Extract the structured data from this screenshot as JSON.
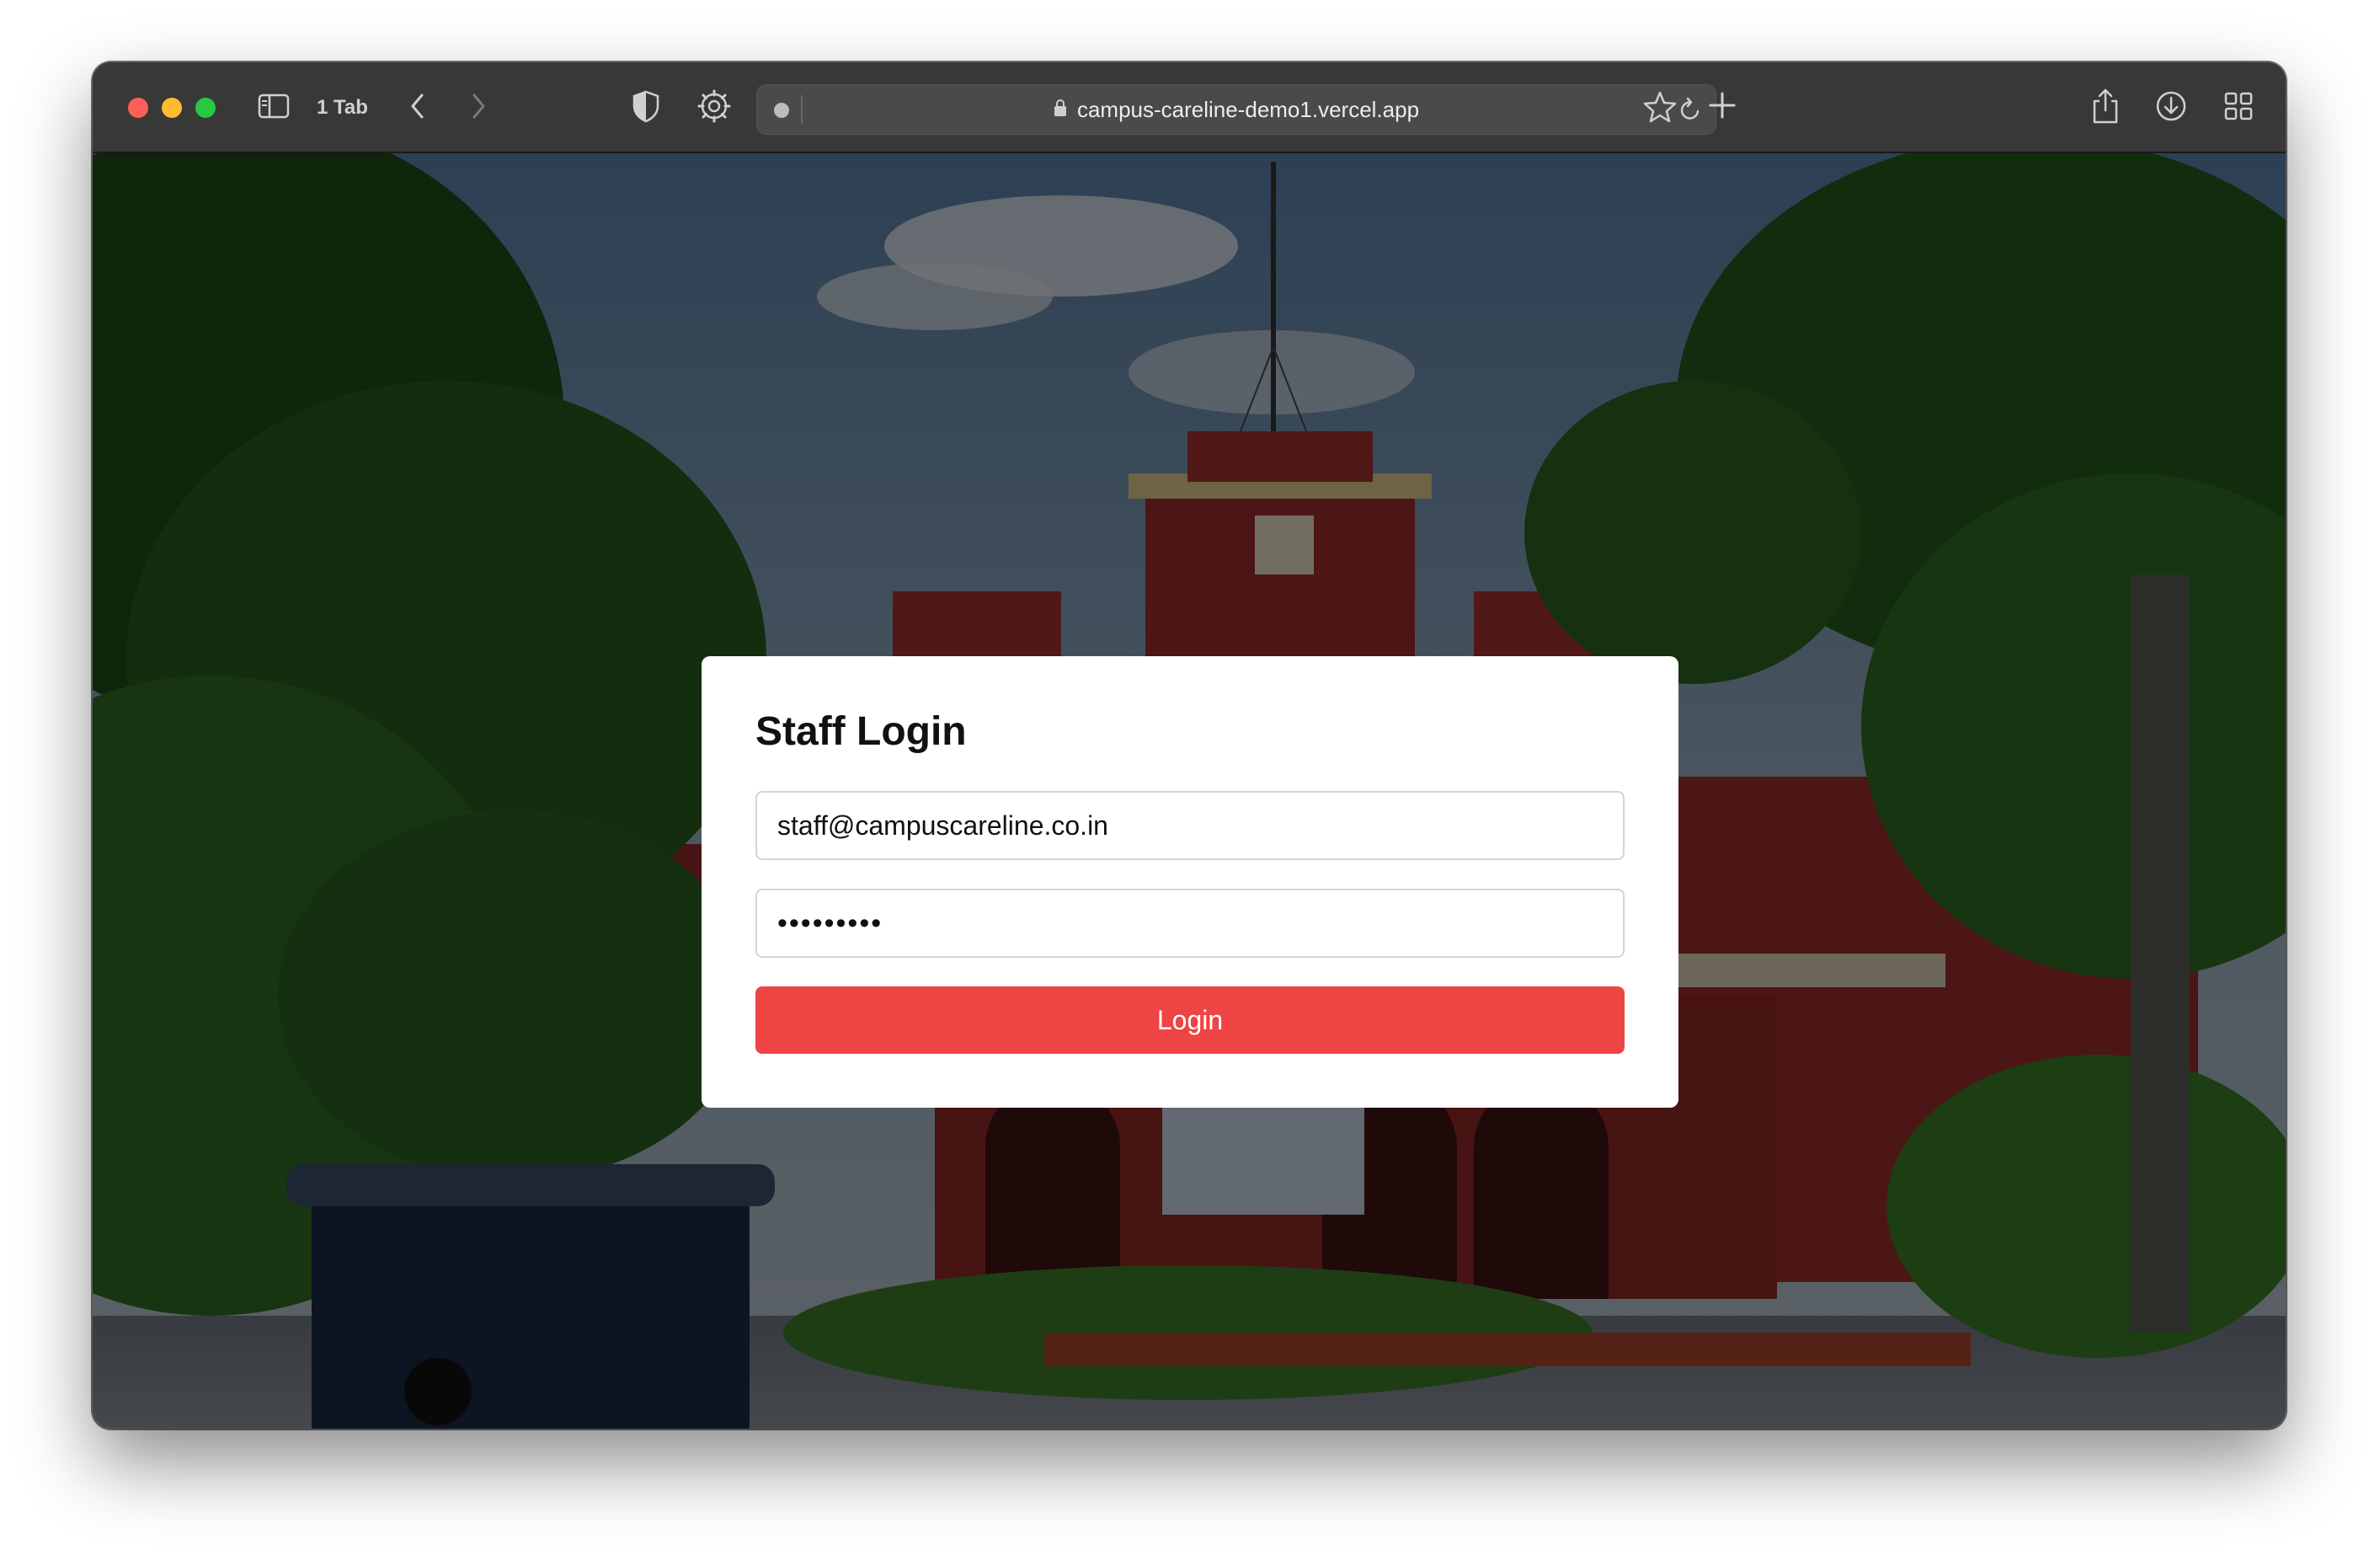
{
  "browser": {
    "tab_count_label": "1 Tab",
    "url": "campus-careline-demo1.vercel.app",
    "icons": {
      "sidebar": "sidebar-icon",
      "back": "chevron-left-icon",
      "forward": "chevron-right-icon",
      "shield": "shield-icon",
      "extension": "gear-icon",
      "lock": "lock-icon",
      "reload": "reload-icon",
      "bookmark": "star-icon",
      "new_tab": "plus-icon",
      "share": "share-icon",
      "downloads": "download-icon",
      "tab_overview": "grid-icon"
    }
  },
  "login": {
    "title": "Staff Login",
    "email_value": "staff@campuscareline.co.in",
    "password_value": "password1",
    "button_label": "Login"
  },
  "colors": {
    "accent": "#ef4444",
    "toolbar": "#383838"
  }
}
